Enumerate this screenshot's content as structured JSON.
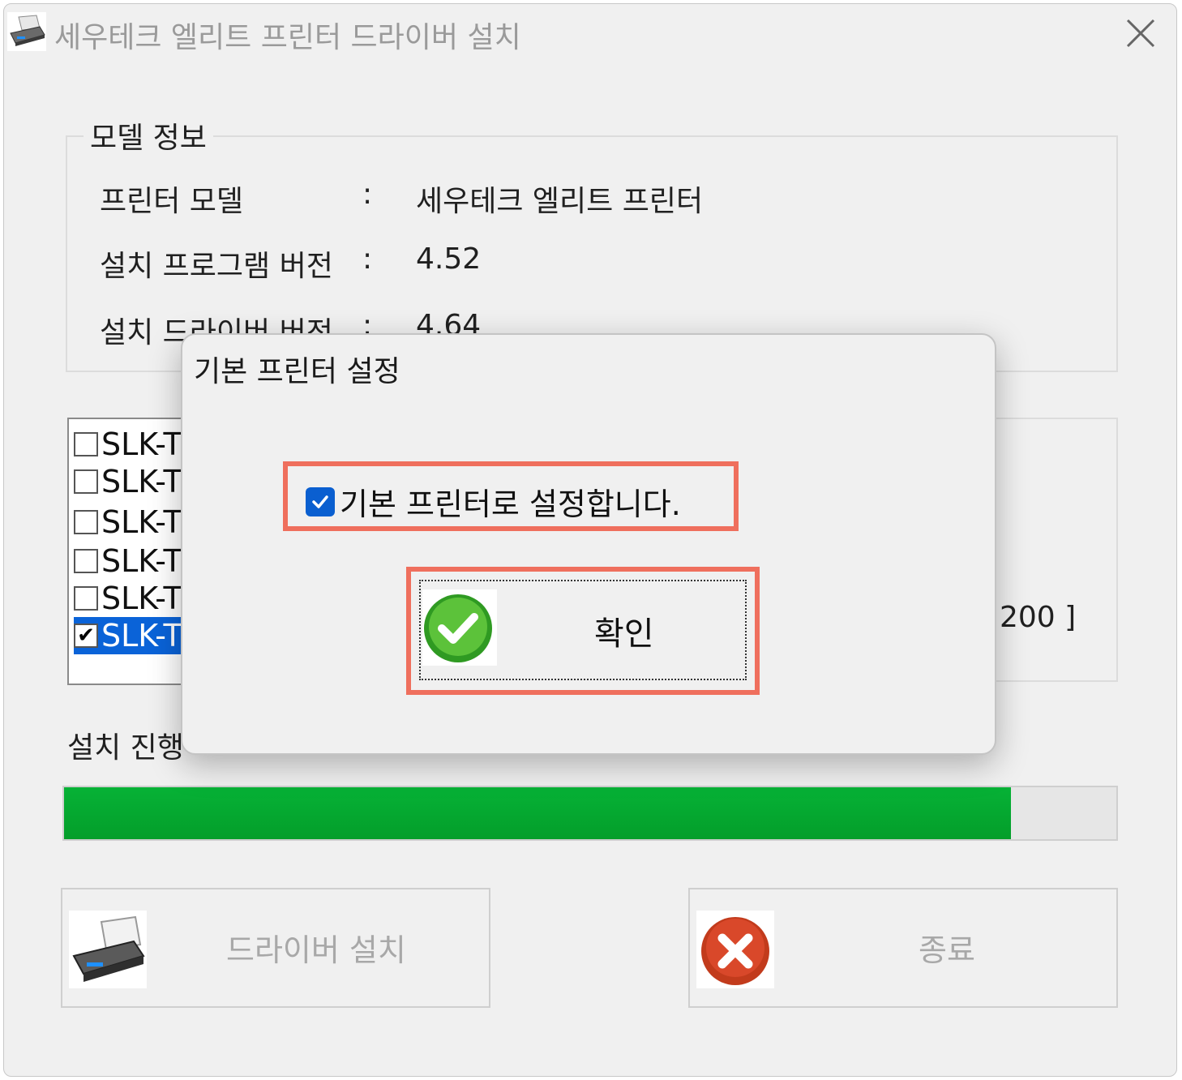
{
  "window": {
    "title": "세우테크 엘리트 프린터 드라이버 설치"
  },
  "model_info": {
    "group_title": "모델 정보",
    "rows": [
      {
        "label": "프린터 모델",
        "colon": ":",
        "value": "세우테크 엘리트 프린터"
      },
      {
        "label": "설치 프로그램 버전",
        "colon": ":",
        "value": "4.52"
      },
      {
        "label": "설치 드라이버 버전",
        "colon": ":",
        "value": "4.64"
      }
    ]
  },
  "printer_list": {
    "items": [
      {
        "label": "SLK-T",
        "checked": false
      },
      {
        "label": "SLK-T",
        "checked": false
      },
      {
        "label": "SLK-T",
        "checked": false
      },
      {
        "label": "SLK-T",
        "checked": false
      },
      {
        "label": "SLK-T",
        "checked": false
      },
      {
        "label": "SLK-T",
        "checked": true,
        "selected": true
      }
    ],
    "check_mark": "✔"
  },
  "right_panel": {
    "text": "200 ]"
  },
  "progress": {
    "label": "설치 진행",
    "value_fraction": 0.9,
    "color": "#06b236"
  },
  "buttons": {
    "install_label": "드라이버 설치",
    "exit_label": "종료"
  },
  "dialog": {
    "title": "기본 프린터 설정",
    "checkbox_label": "기본 프린터로 설정합니다.",
    "checkbox_checked": true,
    "ok_label": "확인",
    "highlight_color": "#ef6f5d"
  }
}
